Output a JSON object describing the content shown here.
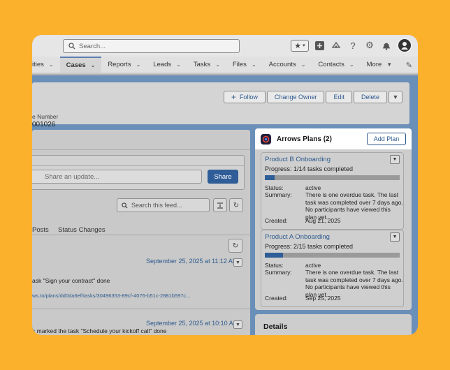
{
  "header": {
    "search_placeholder": "Search...",
    "icons": [
      "star-icon",
      "plus-icon",
      "trailhead-icon",
      "help-icon",
      "setup-gear-icon",
      "bell-icon",
      "avatar"
    ]
  },
  "nav": {
    "items": [
      {
        "label": "ities",
        "active": false
      },
      {
        "label": "Cases",
        "active": true
      },
      {
        "label": "Reports",
        "active": false
      },
      {
        "label": "Leads",
        "active": false
      },
      {
        "label": "Tasks",
        "active": false
      },
      {
        "label": "Files",
        "active": false
      },
      {
        "label": "Accounts",
        "active": false
      },
      {
        "label": "Contacts",
        "active": false
      },
      {
        "label": "More",
        "active": false
      }
    ]
  },
  "record": {
    "follow_label": "Follow",
    "change_owner_label": "Change Owner",
    "edit_label": "Edit",
    "delete_label": "Delete",
    "field_label": "e Number",
    "field_value": "001026"
  },
  "feed": {
    "post_placeholder": "Share an update...",
    "share_label": "Share",
    "search_placeholder": "Search this feed...",
    "tab_posts": "Posts",
    "tab_status_changes": "Status Changes",
    "items": [
      {
        "timestamp": "September 25, 2025 at 11:12 AM",
        "text": "ask \"Sign your contract\" done",
        "link": "ws.to/plans/dd0da6ef/tasks/30496353-89cf-4076-b51c-2881b597c..."
      },
      {
        "timestamp": "September 25, 2025 at 10:10 AM",
        "text": "s marked the task \"Schedule your kickoff call\" done"
      }
    ]
  },
  "plans": {
    "title": "Arrows Plans (2)",
    "add_label": "Add Plan",
    "status_label": "Status:",
    "summary_label": "Summary:",
    "created_label": "Created:",
    "cards": [
      {
        "name": "Product B Onboarding",
        "progress_text": "Progress: 1/14 tasks completed",
        "progress_fraction": 0.0714,
        "status": "active",
        "summary": "There is one overdue task. The last task was completed over 7 days ago. No participants have viewed this plan yet.",
        "created": "Aug 21, 2025"
      },
      {
        "name": "Product A Onboarding",
        "progress_text": "Progress: 2/15 tasks completed",
        "progress_fraction": 0.1333,
        "status": "active",
        "summary": "There is one overdue task. The last task was completed over 7 days ago. No participants have viewed this plan yet.",
        "created": "Sep 25, 2025"
      }
    ]
  },
  "details": {
    "title": "Details"
  },
  "colors": {
    "background": "#FBB12C",
    "brand_blue": "#2f5d98",
    "link_blue": "#2d5a8e"
  }
}
